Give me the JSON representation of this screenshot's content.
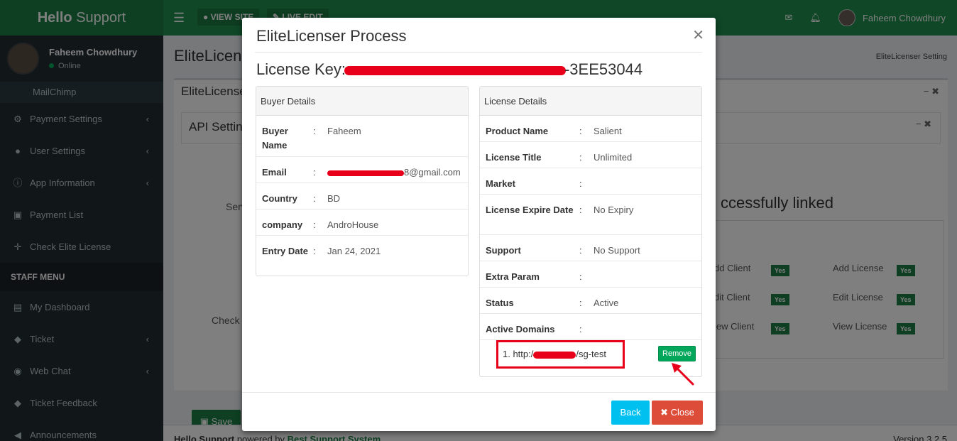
{
  "app": {
    "brand_bold": "Hello",
    "brand_rest": " Support",
    "top_buttons": [
      "VIEW SITE",
      "LIVE EDIT"
    ],
    "user_name": "Faheem Chowdhury"
  },
  "sidebar": {
    "user_name": "Faheem Chowdhury",
    "user_status": "Online",
    "sub_item": "MailChimp",
    "items": [
      {
        "label": "Payment Settings",
        "icon": "cog-icon",
        "chevron": "‹"
      },
      {
        "label": "User Settings",
        "icon": "user-icon",
        "chevron": "‹"
      },
      {
        "label": "App Information",
        "icon": "info-icon",
        "chevron": "‹"
      },
      {
        "label": "Payment List",
        "icon": "money-icon",
        "chevron": ""
      },
      {
        "label": "Check Elite License",
        "icon": "crosshair-icon",
        "chevron": ""
      }
    ],
    "staff_header": "STAFF MENU",
    "staff_items": [
      {
        "label": "My Dashboard",
        "icon": "dashboard-icon",
        "chevron": ""
      },
      {
        "label": "Ticket",
        "icon": "ticket-icon",
        "chevron": "‹"
      },
      {
        "label": "Web Chat",
        "icon": "chat-icon",
        "chevron": "‹"
      },
      {
        "label": "Ticket Feedback",
        "icon": "feedback-icon",
        "chevron": ""
      },
      {
        "label": "Announcements",
        "icon": "bullhorn-icon",
        "chevron": ""
      }
    ]
  },
  "content": {
    "page_title": "EliteLicen",
    "breadcrumb": "EliteLicenser Setting",
    "box_title": "EliteLicense",
    "inner_box_title": "API Setting",
    "success_text": "ccessfully linked",
    "server_label": "Serve",
    "check_support_label": "Check Su",
    "permissions": [
      {
        "label": "dd Client",
        "value": "Yes"
      },
      {
        "label": "Add License",
        "value": "Yes"
      },
      {
        "label": "dit Client",
        "value": "Yes"
      },
      {
        "label": "Edit License",
        "value": "Yes"
      },
      {
        "label": "iew Client",
        "value": "Yes"
      },
      {
        "label": "View License",
        "value": "Yes"
      }
    ],
    "save_label": "Save"
  },
  "footer": {
    "left_prefix": "Hello Support",
    "left_mid": " powered by ",
    "left_link": "Best Support System",
    "version": "Version 3.2.5"
  },
  "modal": {
    "title": "EliteLicenser Process",
    "license_key_label": "License Key:",
    "license_key_suffix": "-3EE53044",
    "buyer": {
      "heading": "Buyer Details",
      "rows": [
        {
          "key": "Buyer Name",
          "value": "Faheem"
        },
        {
          "key": "Email",
          "value": "8@gmail.com"
        },
        {
          "key": "Country",
          "value": "BD"
        },
        {
          "key": "company",
          "value": "AndroHouse"
        },
        {
          "key": "Entry Date",
          "value": "Jan 24, 2021"
        }
      ]
    },
    "license": {
      "heading": "License Details",
      "rows": [
        {
          "key": "Product Name",
          "value": "Salient"
        },
        {
          "key": "License Title",
          "value": "Unlimited"
        },
        {
          "key": "Market",
          "value": ""
        },
        {
          "key": "License Expire Date",
          "value": "No Expiry"
        },
        {
          "key": "Support",
          "value": "No Support"
        },
        {
          "key": "Extra Param",
          "value": ""
        },
        {
          "key": "Status",
          "value": "Active"
        },
        {
          "key": "Active Domains",
          "value": ""
        }
      ],
      "domain_prefix": "1. http:/",
      "domain_suffix": "/sg-test",
      "remove_label": "Remove"
    },
    "back_label": "Back",
    "close_label": "Close",
    "colon": ":"
  }
}
